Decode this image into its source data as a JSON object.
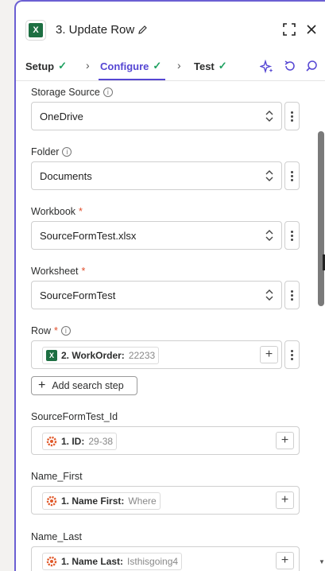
{
  "header": {
    "title": "3. Update Row",
    "app_icon": "excel-icon"
  },
  "tabs": [
    {
      "label": "Setup",
      "status": "complete"
    },
    {
      "label": "Configure",
      "status": "complete",
      "active": true
    },
    {
      "label": "Test",
      "status": "complete"
    }
  ],
  "fields": {
    "storage_source": {
      "label": "Storage Source",
      "value": "OneDrive"
    },
    "folder": {
      "label": "Folder",
      "value": "Documents"
    },
    "workbook": {
      "label": "Workbook",
      "value": "SourceFormTest.xlsx",
      "required": "*"
    },
    "worksheet": {
      "label": "Worksheet",
      "value": "SourceFormTest",
      "required": "*"
    },
    "row": {
      "label": "Row",
      "required": "*",
      "pill_key": "2. WorkOrder:",
      "pill_value": "22233"
    },
    "add_search_step": "Add search step",
    "source_id": {
      "label": "SourceFormTest_Id",
      "pill_key": "1. ID:",
      "pill_value": "29-38"
    },
    "name_first": {
      "label": "Name_First",
      "pill_key": "1. Name First:",
      "pill_value": "Where"
    },
    "name_last": {
      "label": "Name_Last",
      "pill_key": "1. Name Last:",
      "pill_value": "Isthisgoing4"
    }
  },
  "colors": {
    "accent": "#5546d3",
    "check": "#1fa161",
    "excel": "#1d6f42",
    "required": "#e04e2b"
  }
}
